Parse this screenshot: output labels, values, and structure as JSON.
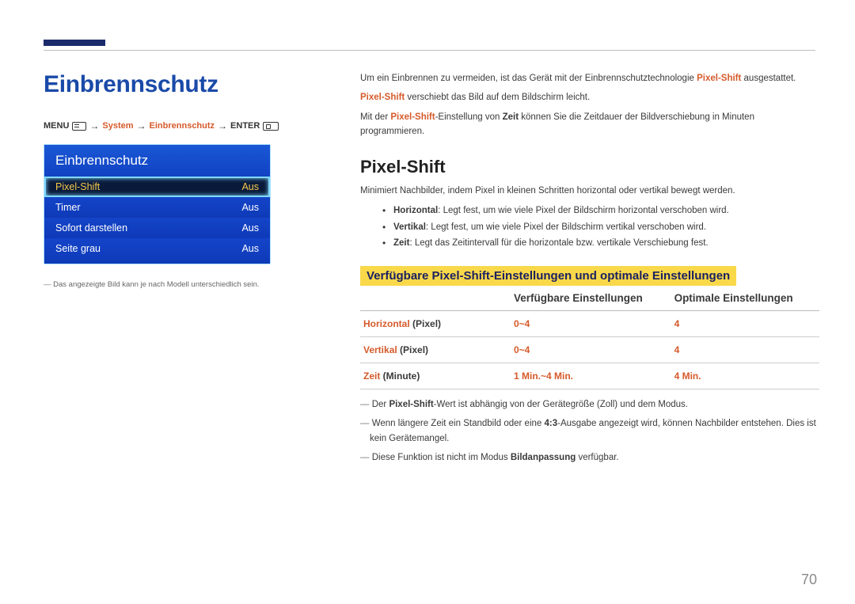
{
  "header": {
    "title": "Einbrennschutz"
  },
  "breadcrumb": {
    "menu": "MENU",
    "system": "System",
    "item": "Einbrennschutz",
    "enter": "ENTER"
  },
  "osd": {
    "title": "Einbrennschutz",
    "rows": [
      {
        "label": "Pixel-Shift",
        "value": "Aus"
      },
      {
        "label": "Timer",
        "value": "Aus"
      },
      {
        "label": "Sofort darstellen",
        "value": "Aus"
      },
      {
        "label": "Seite grau",
        "value": "Aus"
      }
    ]
  },
  "footnotes": {
    "model_may_differ": "Das angezeigte Bild kann je nach Modell unterschiedlich sein."
  },
  "intro": {
    "line1_a": "Um ein Einbrennen zu vermeiden, ist das Gerät mit der Einbrennschutztechnologie ",
    "line1_b": "Pixel-Shift",
    "line1_c": " ausgestattet.",
    "line2_a": "Pixel-Shift",
    "line2_b": " verschiebt das Bild auf dem Bildschirm leicht.",
    "line3_a": "Mit der ",
    "line3_b": "Pixel-Shift",
    "line3_c": "-Einstellung von ",
    "line3_d": "Zeit",
    "line3_e": " können Sie die Zeitdauer der Bildverschiebung in Minuten programmieren."
  },
  "section": {
    "heading": "Pixel-Shift",
    "desc": "Minimiert Nachbilder, indem Pixel in kleinen Schritten horizontal oder vertikal bewegt werden.",
    "bullets": [
      {
        "term": "Horizontal",
        "text": ": Legt fest, um wie viele Pixel der Bildschirm horizontal verschoben wird."
      },
      {
        "term": "Vertikal",
        "text": ": Legt fest, um wie viele Pixel der Bildschirm vertikal verschoben wird."
      },
      {
        "term": "Zeit",
        "text": ": Legt das Zeitintervall für die horizontale bzw. vertikale Verschiebung fest."
      }
    ]
  },
  "table": {
    "highlight": "Verfügbare Pixel-Shift-Einstellungen und optimale Einstellungen",
    "col_available": "Verfügbare Einstellungen",
    "col_optimal": "Optimale Einstellungen",
    "rows": [
      {
        "param_a": "Horizontal",
        "param_b": " (Pixel)",
        "avail": "0~4",
        "opt": "4"
      },
      {
        "param_a": "Vertikal",
        "param_b": " (Pixel)",
        "avail": "0~4",
        "opt": "4"
      },
      {
        "param_a": "Zeit",
        "param_b": " (Minute)",
        "avail": "1 Min.~4 Min.",
        "opt": "4 Min."
      }
    ]
  },
  "table_notes": {
    "n1_a": "Der ",
    "n1_b": "Pixel-Shift",
    "n1_c": "-Wert ist abhängig von der Gerätegröße (Zoll) und dem Modus.",
    "n2_a": "Wenn längere Zeit ein Standbild oder eine ",
    "n2_b": "4:3",
    "n2_c": "-Ausgabe angezeigt wird, können Nachbilder entstehen. Dies ist kein Gerätemangel.",
    "n3_a": "Diese Funktion ist nicht im Modus ",
    "n3_b": "Bildanpassung",
    "n3_c": " verfügbar."
  },
  "page_number": "70"
}
